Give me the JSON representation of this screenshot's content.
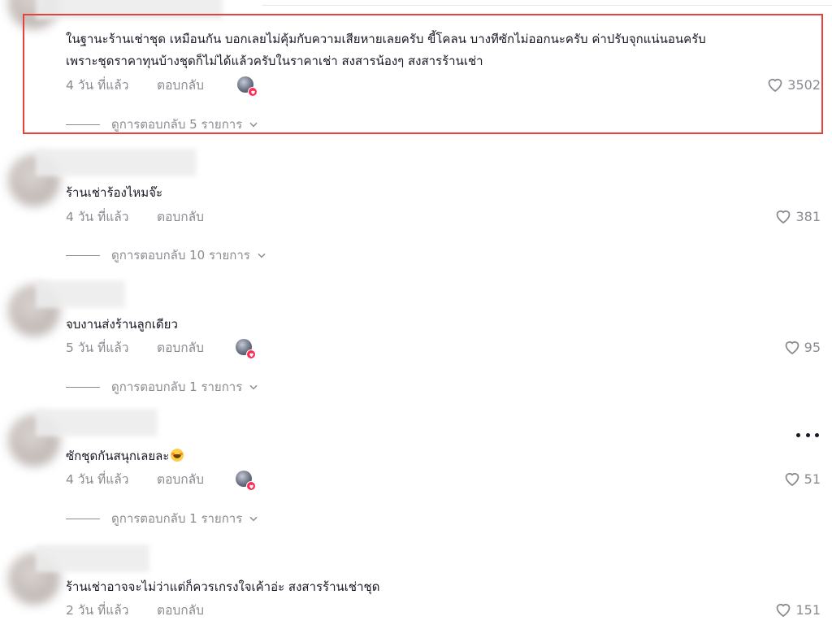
{
  "comments": [
    {
      "text_line1": "ในฐานะร้านเช่าชุด เหมือนกัน บอกเลยไม่คุ้มกับความเสียหายเลยครับ ขี้โคลน บางทีซักไม่ออกนะครับ ค่าปรับจุกแน่นอนครับ",
      "text_line2": "เพราะชุดราคาทุนบ้างชุดก็ไม่ได้แล้วครับในราคาเช่า สงสารน้องๆ สงสารร้านเช่า",
      "time": "4 วัน ที่แล้ว",
      "reply": "ตอบกลับ",
      "likes": "3502",
      "view_replies": "ดูการตอบกลับ 5 รายการ"
    },
    {
      "text": "ร้านเช่าร้องไหมจ๊ะ",
      "time": "4 วัน ที่แล้ว",
      "reply": "ตอบกลับ",
      "likes": "381",
      "view_replies": "ดูการตอบกลับ 10 รายการ"
    },
    {
      "text": "จบงานส่งร้านลูกเดียว",
      "time": "5 วัน ที่แล้ว",
      "reply": "ตอบกลับ",
      "likes": "95",
      "view_replies": "ดูการตอบกลับ 1 รายการ"
    },
    {
      "text": "ซักชุดกันสนุกเลยละ",
      "time": "4 วัน ที่แล้ว",
      "reply": "ตอบกลับ",
      "likes": "51",
      "view_replies": "ดูการตอบกลับ 1 รายการ"
    },
    {
      "text": "ร้านเช่าอาจจะไม่ว่าแต่ก็ควรเกรงใจเค้าอ่ะ สงสารร้านเช่าชุด",
      "time": "2 วัน ที่แล้ว",
      "reply": "ตอบกลับ",
      "likes": "151"
    }
  ],
  "colors": {
    "highlight": "#e8413b",
    "secondary_text": "#8a8b91",
    "primary_text": "#161823",
    "creator_heart": "#fe2c55"
  },
  "icons": {
    "like": "heart-outline-icon",
    "expand": "chevron-down-icon",
    "more": "more-horizontal-icon",
    "creator_liked": "creator-liked-badge"
  }
}
